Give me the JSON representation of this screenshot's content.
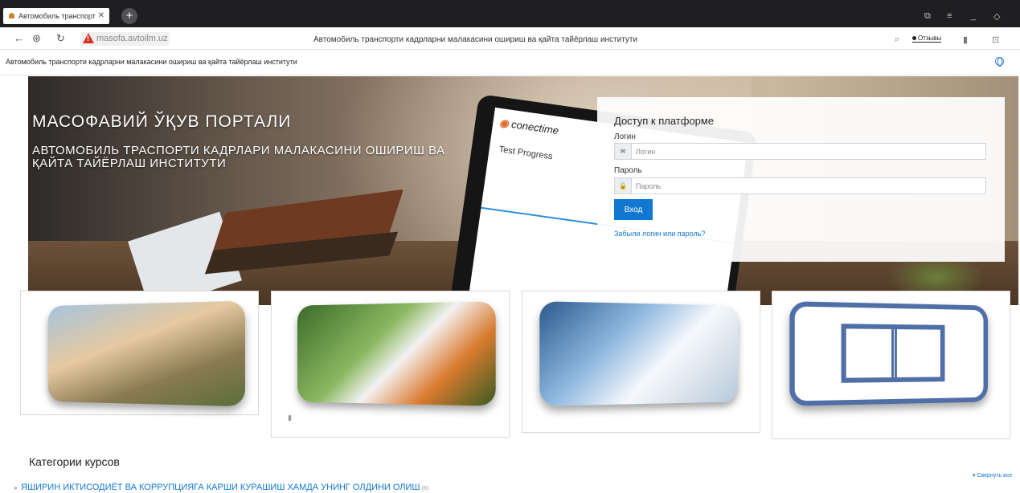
{
  "browser": {
    "tab_title": "Автомобиль транспорт",
    "url": "masofa.avtoilm.uz",
    "page_title": "Автомобиль транспорти кадрларни малакасини ошириш ва қайта тайёрлаш институти",
    "reviews_label": "Отзывы"
  },
  "site": {
    "name": "Автомобиль транспорти кадрларни малакасини ошириш ва қайта тайёрлаш институти"
  },
  "hero": {
    "title": "МАСОФАВИЙ ЎҚУВ ПОРТАЛИ",
    "subtitle": "АВТОМОБИЛЬ ТРАСПОРТИ КАДРЛАРИ МАЛАКАСИНИ ОШИРИШ ВА ҚАЙТА ТАЙЁРЛАШ ИНСТИТУТИ",
    "tablet_logo": "conectime",
    "tablet_heading": "Test Progress"
  },
  "login": {
    "heading": "Доступ к платформе",
    "username_label": "Логин",
    "username_placeholder": "Логин",
    "password_label": "Пароль",
    "password_placeholder": "Пароль",
    "submit_label": "Вход",
    "forgot_link": "Забыли логин или пароль?"
  },
  "categories": {
    "heading": "Категории курсов",
    "collapse_all": "Свернуть все",
    "items": [
      {
        "label": "ЯШИРИН ИКТИСОДИЁТ ВА КОРРУПЦИЯГА КАРШИ КУРАШИШ ХАМДА УНИНГ ОЛДИНИ ОЛИШ",
        "count": "(6)"
      }
    ]
  }
}
